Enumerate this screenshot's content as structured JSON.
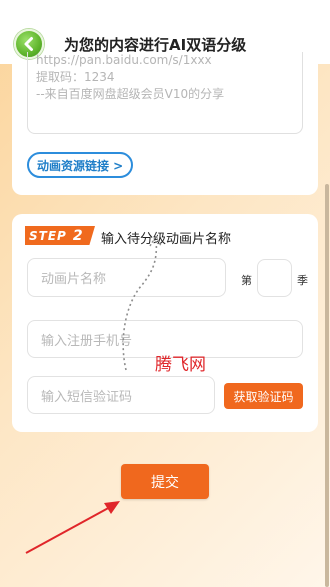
{
  "header": {
    "title": "为您的内容进行AI双语分级"
  },
  "share_box": {
    "lines": [
      "https://pan.baidu.com/s/1xxx",
      "提取码：1234",
      "--来自百度网盘超级会员V10的分享"
    ],
    "link_label": "动画资源链接 >"
  },
  "step2": {
    "badge_word": "STEP",
    "badge_num": "2",
    "title": "输入待分级动画片名称",
    "name_placeholder": "动画片名称",
    "episode_prefix": "第",
    "episode_suffix": "季",
    "episode_placeholder": "",
    "phone_placeholder": "输入注册手机号",
    "code_placeholder": "输入短信验证码",
    "code_button": "获取验证码"
  },
  "watermark": "腾飞网",
  "submit_label": "提交",
  "colors": {
    "accent": "#f0681e",
    "link": "#2c8ddc",
    "back_button": "#5fb52c",
    "annotation": "#e0262a"
  },
  "icons": {
    "back": "chevron-left-icon"
  }
}
